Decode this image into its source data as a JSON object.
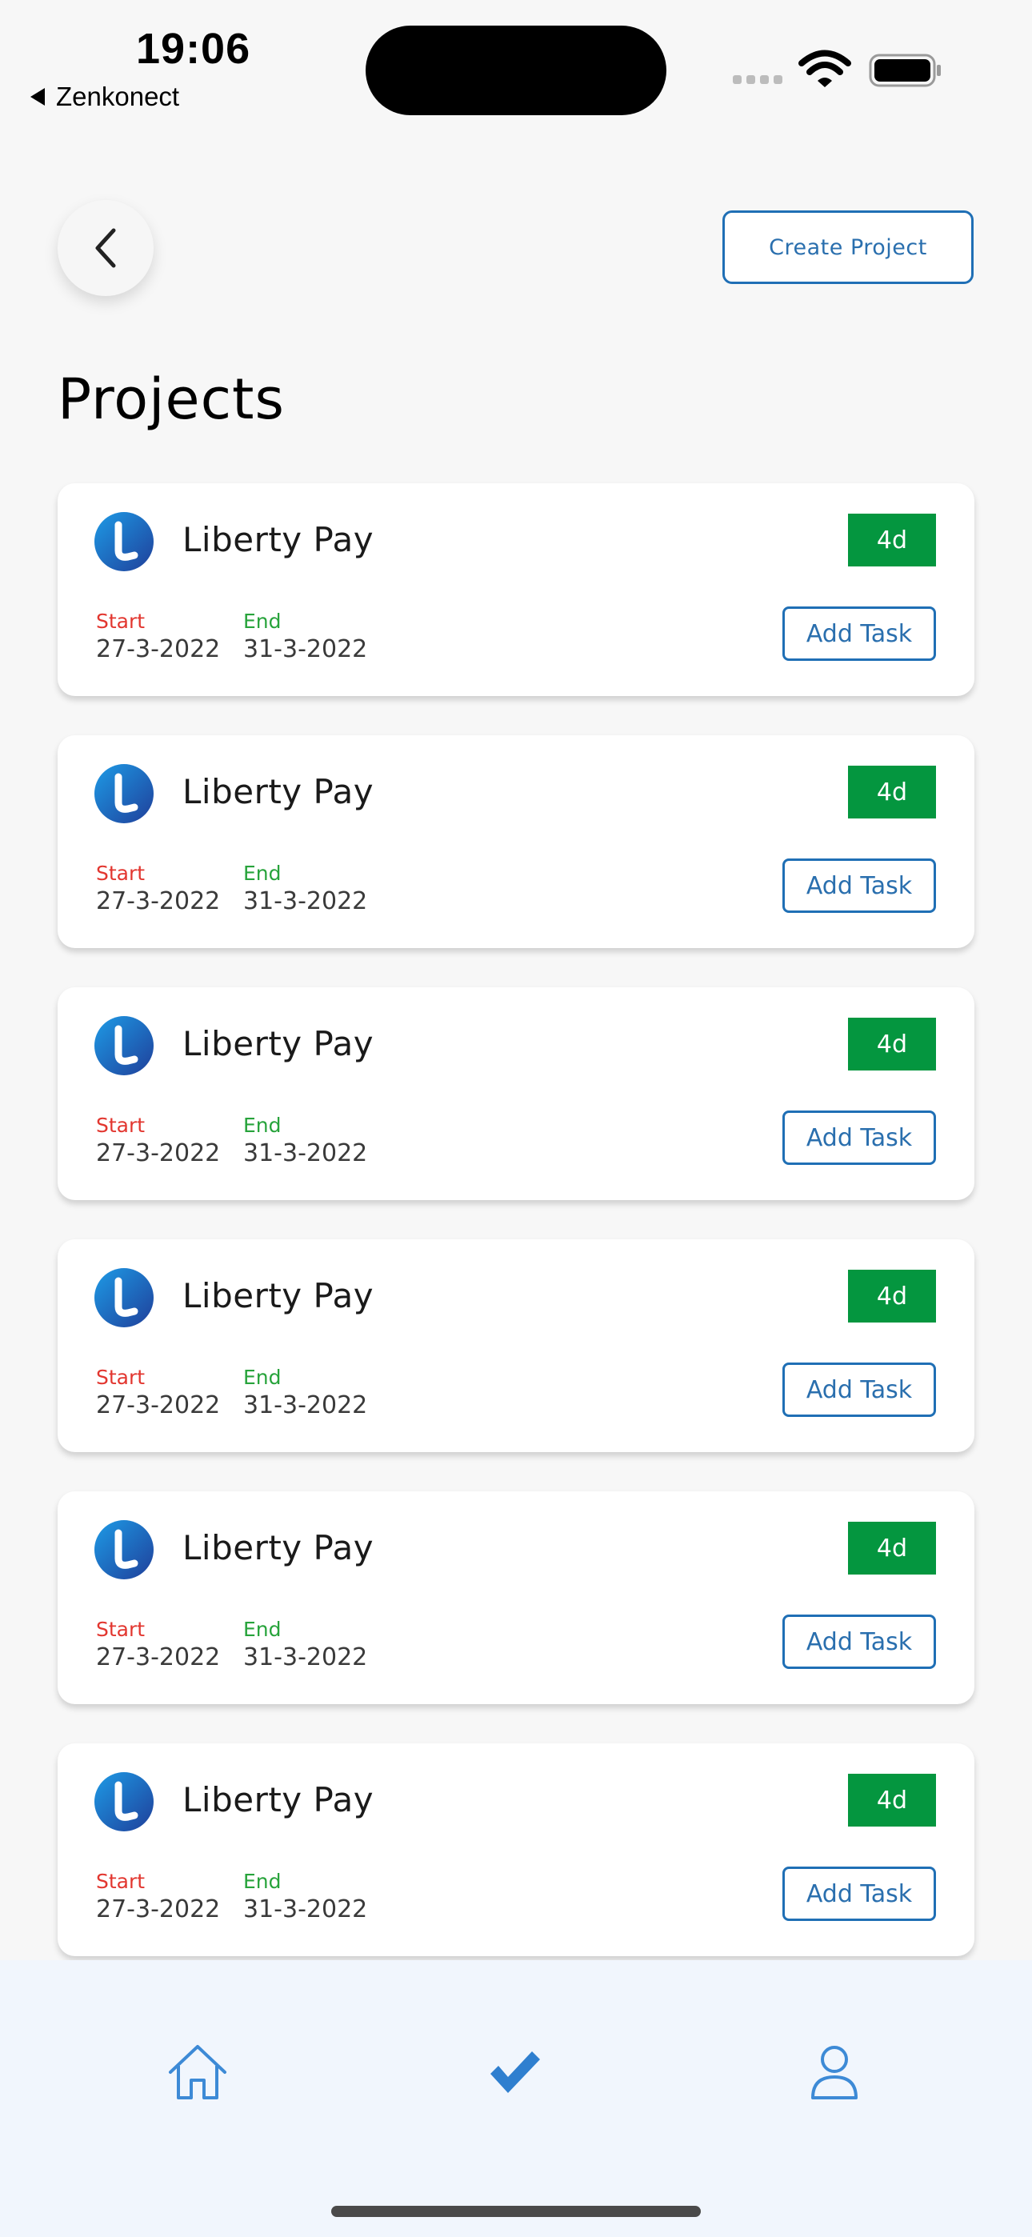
{
  "status_bar": {
    "time": "19:06",
    "back_app": "Zenkonect"
  },
  "header": {
    "create_project_label": "Create Project",
    "title": "Projects"
  },
  "projects": [
    {
      "name": "Liberty Pay",
      "duration": "4d",
      "start_label": "Start",
      "start_date": "27-3-2022",
      "end_label": "End",
      "end_date": "31-3-2022",
      "add_task_label": "Add Task"
    },
    {
      "name": "Liberty Pay",
      "duration": "4d",
      "start_label": "Start",
      "start_date": "27-3-2022",
      "end_label": "End",
      "end_date": "31-3-2022",
      "add_task_label": "Add Task"
    },
    {
      "name": "Liberty Pay",
      "duration": "4d",
      "start_label": "Start",
      "start_date": "27-3-2022",
      "end_label": "End",
      "end_date": "31-3-2022",
      "add_task_label": "Add Task"
    },
    {
      "name": "Liberty Pay",
      "duration": "4d",
      "start_label": "Start",
      "start_date": "27-3-2022",
      "end_label": "End",
      "end_date": "31-3-2022",
      "add_task_label": "Add Task"
    },
    {
      "name": "Liberty Pay",
      "duration": "4d",
      "start_label": "Start",
      "start_date": "27-3-2022",
      "end_label": "End",
      "end_date": "31-3-2022",
      "add_task_label": "Add Task"
    },
    {
      "name": "Liberty Pay",
      "duration": "4d",
      "start_label": "Start",
      "start_date": "27-3-2022",
      "end_label": "End",
      "end_date": "31-3-2022",
      "add_task_label": "Add Task"
    }
  ],
  "bottom_nav": {
    "items": [
      {
        "icon": "home-icon"
      },
      {
        "icon": "checkmark-icon",
        "active": true
      },
      {
        "icon": "profile-icon"
      }
    ]
  },
  "colors": {
    "accent": "#1f6fb5",
    "badge_green": "#04963f",
    "start_red": "#e2362f",
    "end_green": "#27a33b",
    "nav_background": "#f1f6fd"
  }
}
